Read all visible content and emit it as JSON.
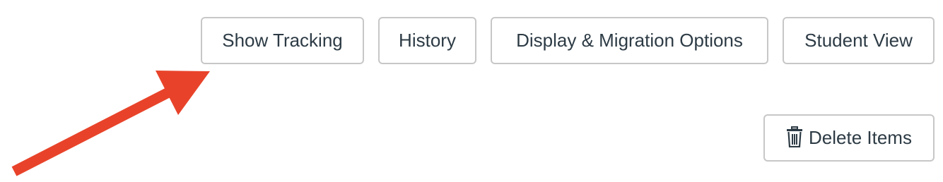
{
  "toolbar": {
    "show_tracking_label": "Show Tracking",
    "history_label": "History",
    "display_migration_label": "Display & Migration Options",
    "student_view_label": "Student View"
  },
  "actions": {
    "delete_items_label": "Delete Items",
    "delete_icon": "trash-icon"
  },
  "annotation": {
    "arrow_color": "#e8432a",
    "points_to": "Show Tracking"
  },
  "colors": {
    "button_border": "#c7c7c7",
    "button_text": "#2d3b45"
  }
}
